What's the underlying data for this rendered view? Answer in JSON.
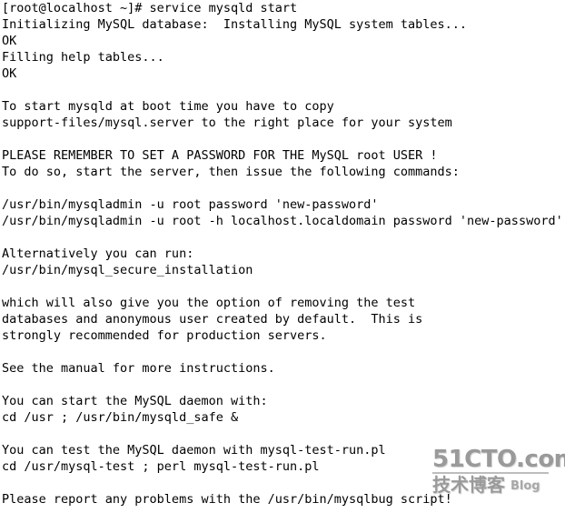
{
  "terminal": {
    "prompt_line": "[root@localhost ~]# service mysqld start",
    "lines": [
      "[root@localhost ~]# service mysqld start",
      "Initializing MySQL database:  Installing MySQL system tables...",
      "OK",
      "Filling help tables...",
      "OK",
      "",
      "To start mysqld at boot time you have to copy",
      "support-files/mysql.server to the right place for your system",
      "",
      "PLEASE REMEMBER TO SET A PASSWORD FOR THE MySQL root USER !",
      "To do so, start the server, then issue the following commands:",
      "",
      "/usr/bin/mysqladmin -u root password 'new-password'",
      "/usr/bin/mysqladmin -u root -h localhost.localdomain password 'new-password'",
      "",
      "Alternatively you can run:",
      "/usr/bin/mysql_secure_installation",
      "",
      "which will also give you the option of removing the test",
      "databases and anonymous user created by default.  This is",
      "strongly recommended for production servers.",
      "",
      "See the manual for more instructions.",
      "",
      "You can start the MySQL daemon with:",
      "cd /usr ; /usr/bin/mysqld_safe &",
      "",
      "You can test the MySQL daemon with mysql-test-run.pl",
      "cd /usr/mysql-test ; perl mysql-test-run.pl",
      "",
      "Please report any problems with the /usr/bin/mysqlbug script!"
    ],
    "colors": {
      "background": "#ffffff",
      "foreground": "#000000"
    }
  },
  "watermark": {
    "brand": "51CTO.com",
    "subtitle_cn": "技术博客",
    "subtitle_en": "Blog",
    "color": "#9a9a9a"
  }
}
